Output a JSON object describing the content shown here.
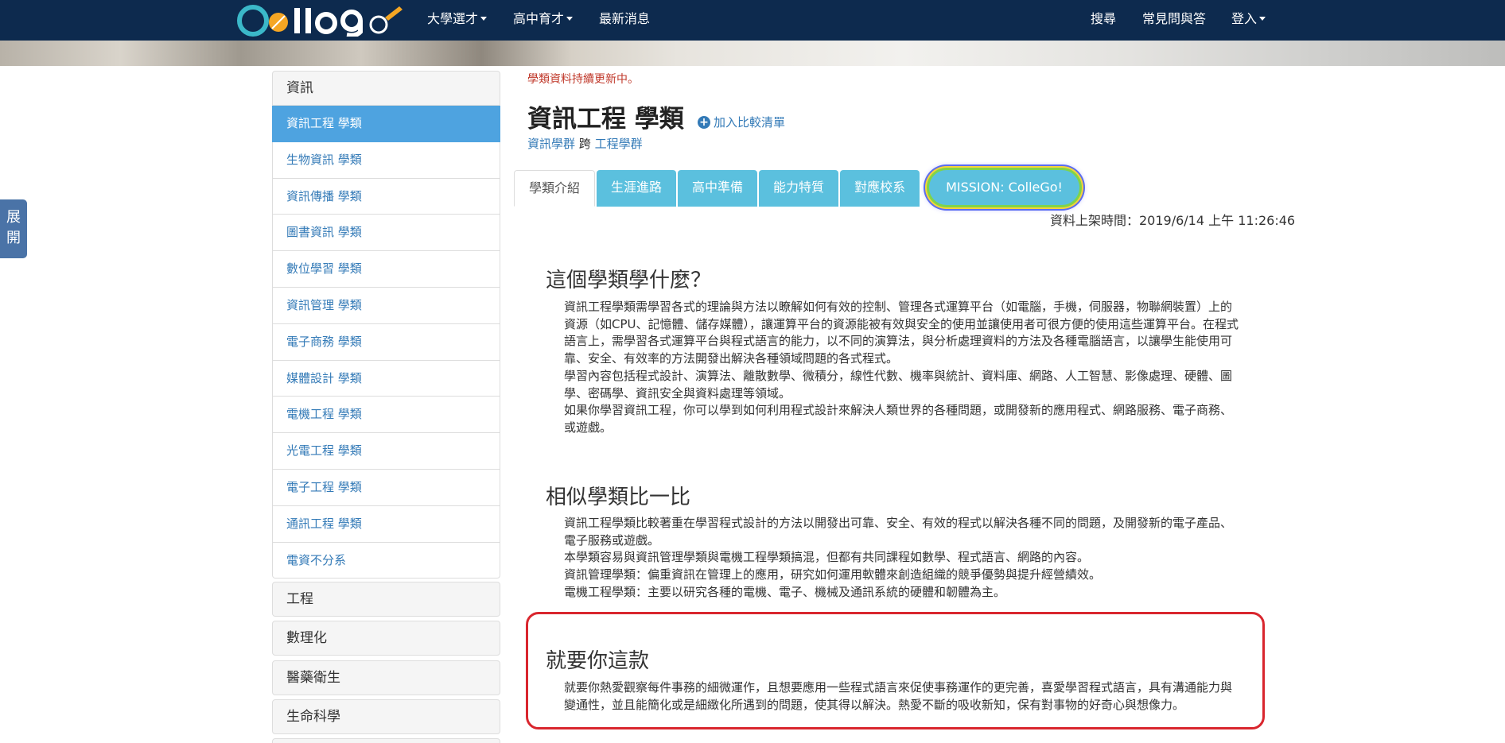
{
  "nav": {
    "logo_text": "Colle9o",
    "items": [
      {
        "label": "大學選才",
        "has_caret": true
      },
      {
        "label": "高中育才",
        "has_caret": true
      },
      {
        "label": "最新消息",
        "has_caret": false
      }
    ],
    "right_items": [
      {
        "label": "搜尋",
        "has_caret": false
      },
      {
        "label": "常見問與答",
        "has_caret": false
      },
      {
        "label": "登入",
        "has_caret": true
      }
    ]
  },
  "side_tab": {
    "label_line1": "展",
    "label_line2": "開"
  },
  "categories": {
    "open_group": "資訊",
    "items": [
      {
        "label": "資訊工程 學類",
        "active": true
      },
      {
        "label": "生物資訊 學類",
        "active": false
      },
      {
        "label": "資訊傳播 學類",
        "active": false
      },
      {
        "label": "圖書資訊 學類",
        "active": false
      },
      {
        "label": "數位學習 學類",
        "active": false
      },
      {
        "label": "資訊管理 學類",
        "active": false
      },
      {
        "label": "電子商務 學類",
        "active": false
      },
      {
        "label": "媒體設計 學類",
        "active": false
      },
      {
        "label": "電機工程 學類",
        "active": false
      },
      {
        "label": "光電工程 學類",
        "active": false
      },
      {
        "label": "電子工程 學類",
        "active": false
      },
      {
        "label": "通訊工程 學類",
        "active": false
      },
      {
        "label": "電資不分系",
        "active": false
      }
    ],
    "other_groups": [
      "工程",
      "數理化",
      "醫藥衛生",
      "生命科學"
    ]
  },
  "main": {
    "update_note": "學類資料持續更新中。",
    "title": "資訊工程 學類",
    "compare_link": "加入比較清單",
    "group_a": "資訊學群",
    "group_sep": "跨",
    "group_b": "工程學群",
    "tabs": [
      {
        "label": "學類介紹",
        "active": true
      },
      {
        "label": "生涯進路",
        "active": false
      },
      {
        "label": "高中準備",
        "active": false
      },
      {
        "label": "能力特質",
        "active": false
      },
      {
        "label": "對應校系",
        "active": false
      },
      {
        "label": "MISSION: ColleGo!",
        "active": false
      }
    ],
    "updated_time": "資料上架時間：2019/6/14 上午 11:26:46",
    "sections": [
      {
        "title": "這個學類學什麼？",
        "paragraphs": [
          "資訊工程學類需學習各式的理論與方法以瞭解如何有效的控制、管理各式運算平台（如電腦，手機，伺服器，物聯網裝置）上的資源（如CPU、記憶體、儲存媒體），讓運算平台的資源能被有效與安全的使用並讓使用者可很方便的使用這些運算平台。在程式語言上，需學習各式運算平台與程式語言的能力，以不同的演算法，與分析處理資料的方法及各種電腦語言，以讓學生能使用可靠、安全、有效率的方法開發出解決各種領域問題的各式程式。",
          "學習內容包括程式設計、演算法、離散數學、微積分，線性代數、機率與統計、資料庫、網路、人工智慧、影像處理、硬體、圖學、密碼學、資訊安全與資料處理等領域。",
          "如果你學習資訊工程，你可以學到如何利用程式設計來解決人類世界的各種問題，或開發新的應用程式、網路服務、電子商務、或遊戲。"
        ]
      },
      {
        "title": "相似學類比一比",
        "paragraphs": [
          "資訊工程學類比較著重在學習程式設計的方法以開發出可靠、安全、有效的程式以解決各種不同的問題，及開發新的電子產品、電子服務或遊戲。",
          "本學類容易與資訊管理學類與電機工程學類搞混，但都有共同課程如數學、程式語言、網路的內容。",
          "資訊管理學類：偏重資訊在管理上的應用，研究如何運用軟體來創造組織的競爭優勢與提升經營績效。",
          "電機工程學類：主要以研究各種的電機、電子、機械及通訊系統的硬體和韌體為主。"
        ]
      },
      {
        "title": "就要你這款",
        "paragraphs": [
          "就要你熱愛觀察每件事務的細微運作，且想要應用一些程式語言來促使事務運作的更完善，喜愛學習程式語言，具有溝通能力與變通性，並且能簡化或是細緻化所遇到的問題，使其得以解決。熱愛不斷的吸收新知，保有對事物的好奇心與想像力。"
        ]
      }
    ]
  }
}
